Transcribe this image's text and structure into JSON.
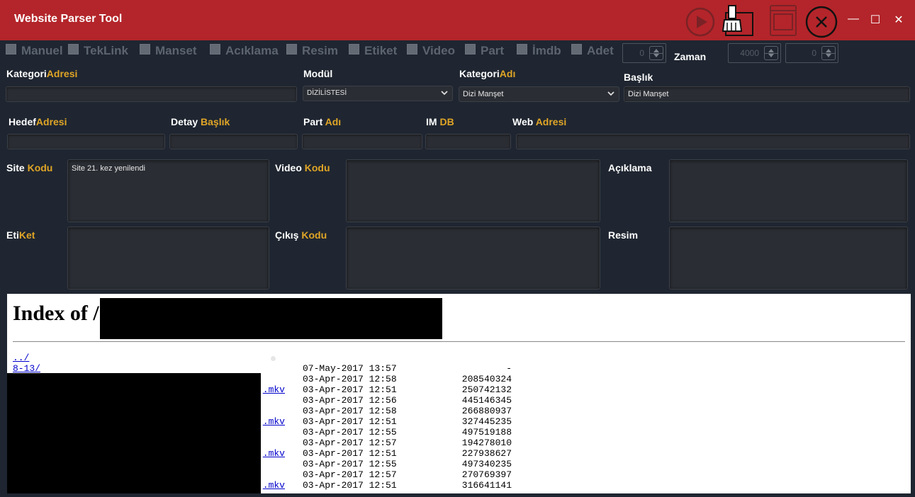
{
  "window": {
    "title": "Website Parser Tool",
    "controls": [
      "—",
      "☐",
      "✕"
    ]
  },
  "toolbar": {
    "icons": [
      "play-icon",
      "broom-icon",
      "window-icon",
      "close-circle-icon"
    ]
  },
  "options": {
    "checkboxes": [
      "Manuel",
      "TekLink",
      "Manset",
      "Acıklama",
      "Resim",
      "Etiket",
      "Video",
      "Part",
      "İmdb",
      "Adet"
    ],
    "adet_value": "0",
    "zaman_label": "Zaman",
    "zaman_value": "4000",
    "zaman_value2": "0"
  },
  "labels": {
    "kategori_adresi": [
      "Kategori",
      "Adresi"
    ],
    "modul": "Modül",
    "kategori_adi": [
      "Kategori",
      "Adı"
    ],
    "baslik": "Başlık",
    "hedef_adresi": [
      "Hedef",
      "Adresi"
    ],
    "detay_baslik": [
      "Detay",
      "Başlık"
    ],
    "part_adi": [
      "Part",
      "Adı"
    ],
    "imdb": [
      "IM",
      "DB"
    ],
    "web_adresi": [
      "Web",
      "Adresi"
    ],
    "site_kodu": [
      "Site",
      "Kodu"
    ],
    "video_kodu": [
      "Video",
      "Kodu"
    ],
    "aciklama": "Açıklama",
    "etiket": [
      "Eti",
      "Ket"
    ],
    "cikis_kodu": [
      "Çıkış",
      "Kodu"
    ],
    "resim": "Resim"
  },
  "fields": {
    "modul_selected": "DİZİLİSTESİ",
    "kategori_adi_selected": "Dizi Manşet",
    "baslik_value": "Dizi Manşet",
    "site_kodu_value": "Site 21. kez yenilendi"
  },
  "browser": {
    "heading": "Index of /",
    "listing": [
      {
        "name": "../",
        "date": "",
        "size": ""
      },
      {
        "name": "8-13/",
        "date": "07-May-2017 13:57",
        "size": "-"
      },
      {
        "name": "",
        "date": "03-Apr-2017 12:58",
        "size": "208540324"
      },
      {
        "name": ".mkv",
        "date": "03-Apr-2017 12:51",
        "size": "250742132"
      },
      {
        "name": "",
        "date": "03-Apr-2017 12:56",
        "size": "445146345"
      },
      {
        "name": "",
        "date": "03-Apr-2017 12:58",
        "size": "266880937"
      },
      {
        "name": ".mkv",
        "date": "03-Apr-2017 12:51",
        "size": "327445235"
      },
      {
        "name": "",
        "date": "03-Apr-2017 12:55",
        "size": "497519188"
      },
      {
        "name": "",
        "date": "03-Apr-2017 12:57",
        "size": "194278010"
      },
      {
        "name": ".mkv",
        "date": "03-Apr-2017 12:51",
        "size": "227938627"
      },
      {
        "name": "",
        "date": "03-Apr-2017 12:55",
        "size": "497340235"
      },
      {
        "name": "",
        "date": "03-Apr-2017 12:57",
        "size": "270769397"
      },
      {
        "name": ".mkv",
        "date": "03-Apr-2017 12:51",
        "size": "316641141"
      }
    ]
  },
  "colors": {
    "titlebar": "#b3252a",
    "background": "#1f2631",
    "accent": "#e0a526"
  }
}
